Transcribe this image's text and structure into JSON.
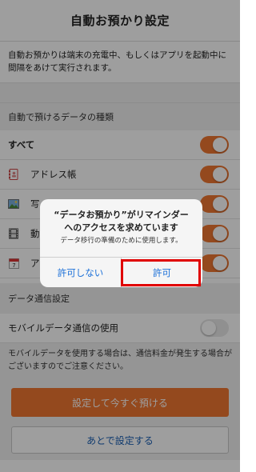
{
  "header": {
    "title": "自動お預かり設定"
  },
  "description": "自動お預かりは端末の充電中、もしくはアプリを起動中に間隔をあけて実行されます。",
  "data_types": {
    "heading": "自動で預けるデータの種類",
    "items": [
      {
        "label": "すべて",
        "icon": "",
        "on": true
      },
      {
        "label": "アドレス帳",
        "icon": "address-book-icon",
        "on": true
      },
      {
        "label": "写",
        "icon": "photo-icon",
        "on": true
      },
      {
        "label": "動",
        "icon": "film-icon",
        "on": true
      },
      {
        "label": "ア",
        "icon": "calendar-icon",
        "on": true
      }
    ]
  },
  "comm": {
    "heading": "データ通信設定",
    "mobile_label": "モバイルデータ通信の使用",
    "mobile_on": false,
    "note": "モバイルデータを使用する場合は、通信料金が発生する場合がございますのでご注意ください。"
  },
  "buttons": {
    "primary": "設定して今すぐ預ける",
    "secondary": "あとで設定する"
  },
  "dialog": {
    "title_line1": "“データお預かり”がリマインダー",
    "title_line2": "へのアクセスを求めています",
    "message": "データ移行の準備のために使用します。",
    "deny": "許可しない",
    "allow": "許可"
  },
  "colors": {
    "accent": "#ef7631",
    "link": "#1a6fd8",
    "highlight": "#e00000"
  }
}
